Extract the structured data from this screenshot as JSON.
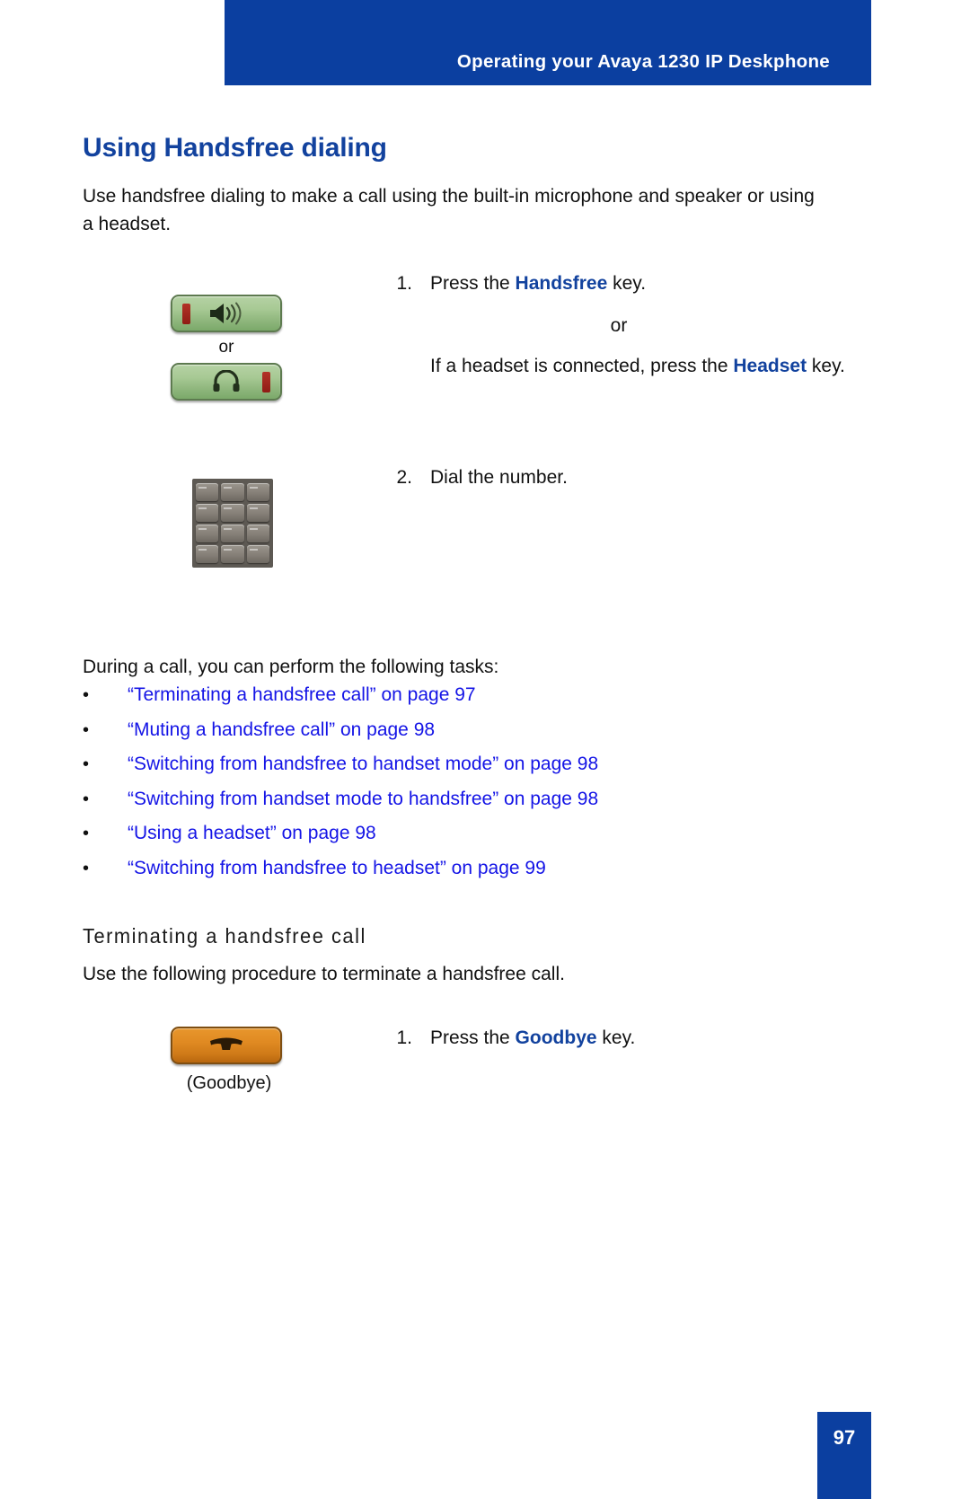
{
  "header": {
    "title": "Operating your Avaya 1230 IP Deskphone",
    "banner_color": "#0B3FA0"
  },
  "page": {
    "title": "Using Handsfree dialing",
    "title_color": "#12429E",
    "intro": "Use handsfree dialing to make a call using the built-in microphone and speaker or using a headset."
  },
  "steps": [
    {
      "number": "1.",
      "text_before": "Press the ",
      "keyword": "Handsfree",
      "text_after": " key.",
      "or_label": "or",
      "alt_text_before": "If a headset is connected, press the ",
      "alt_keyword": "Headset",
      "alt_text_after": " key.",
      "figure_or_label": "or"
    },
    {
      "number": "2.",
      "text": "Dial the number."
    }
  ],
  "tasks": {
    "intro": "During a call, you can perform the following tasks:",
    "bullet_glyph": "•",
    "links": [
      "“Terminating a handsfree call” on page 97",
      "“Muting a handsfree call” on page 98",
      "“Switching from handsfree to handset mode” on page 98",
      "“Switching from handset mode to handsfree” on page 98",
      "“Using a headset” on page 98",
      "“Switching from handsfree to headset” on page 99"
    ],
    "link_color": "#1414E6"
  },
  "section": {
    "heading": "Terminating a handsfree call",
    "paragraph": "Use the following procedure to terminate a handsfree call.",
    "step": {
      "number": "1.",
      "text_before": "Press the ",
      "keyword": "Goodbye",
      "text_after": " key."
    },
    "goodbye_caption": "(Goodbye)"
  },
  "icons": {
    "handsfree": "speaker-icon",
    "headset": "headset-icon",
    "keypad": "dial-keypad-icon",
    "goodbye": "handset-down-icon"
  },
  "footer": {
    "page_number": "97",
    "block_color": "#0B3FA0"
  }
}
